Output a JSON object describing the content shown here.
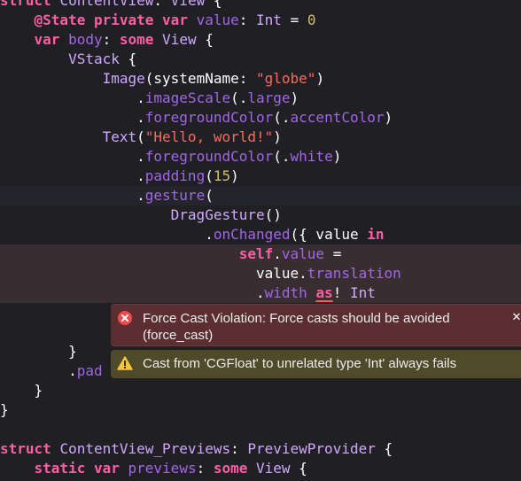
{
  "code_lines": [
    {
      "tokens": [
        {
          "t": "struct ",
          "c": "kw"
        },
        {
          "t": "ContentView",
          "c": "ty"
        },
        {
          "t": ": ",
          "c": "plain"
        },
        {
          "t": "View",
          "c": "ty"
        },
        {
          "t": " {",
          "c": "plain"
        }
      ]
    },
    {
      "tokens": [
        {
          "t": "    ",
          "c": "plain"
        },
        {
          "t": "@State",
          "c": "kw"
        },
        {
          "t": " ",
          "c": "plain"
        },
        {
          "t": "private",
          "c": "kw"
        },
        {
          "t": " ",
          "c": "plain"
        },
        {
          "t": "var",
          "c": "kw"
        },
        {
          "t": " ",
          "c": "plain"
        },
        {
          "t": "value",
          "c": "fn"
        },
        {
          "t": ": ",
          "c": "plain"
        },
        {
          "t": "Int",
          "c": "ty"
        },
        {
          "t": " = ",
          "c": "plain"
        },
        {
          "t": "0",
          "c": "num"
        }
      ]
    },
    {
      "tokens": [
        {
          "t": "    ",
          "c": "plain"
        },
        {
          "t": "var",
          "c": "kw"
        },
        {
          "t": " ",
          "c": "plain"
        },
        {
          "t": "body",
          "c": "fn"
        },
        {
          "t": ": ",
          "c": "plain"
        },
        {
          "t": "some",
          "c": "kw"
        },
        {
          "t": " ",
          "c": "plain"
        },
        {
          "t": "View",
          "c": "ty"
        },
        {
          "t": " {",
          "c": "plain"
        }
      ]
    },
    {
      "tokens": [
        {
          "t": "        ",
          "c": "plain"
        },
        {
          "t": "VStack",
          "c": "ty"
        },
        {
          "t": " {",
          "c": "plain"
        }
      ]
    },
    {
      "tokens": [
        {
          "t": "            ",
          "c": "plain"
        },
        {
          "t": "Image",
          "c": "ty"
        },
        {
          "t": "(systemName: ",
          "c": "plain"
        },
        {
          "t": "\"globe\"",
          "c": "str"
        },
        {
          "t": ")",
          "c": "plain"
        }
      ]
    },
    {
      "tokens": [
        {
          "t": "                .",
          "c": "plain"
        },
        {
          "t": "imageScale",
          "c": "fn"
        },
        {
          "t": "(.",
          "c": "plain"
        },
        {
          "t": "large",
          "c": "fn"
        },
        {
          "t": ")",
          "c": "plain"
        }
      ]
    },
    {
      "tokens": [
        {
          "t": "                .",
          "c": "plain"
        },
        {
          "t": "foregroundColor",
          "c": "fn"
        },
        {
          "t": "(.",
          "c": "plain"
        },
        {
          "t": "accentColor",
          "c": "fn"
        },
        {
          "t": ")",
          "c": "plain"
        }
      ]
    },
    {
      "tokens": [
        {
          "t": "            ",
          "c": "plain"
        },
        {
          "t": "Text",
          "c": "ty"
        },
        {
          "t": "(",
          "c": "plain"
        },
        {
          "t": "\"Hello, world!\"",
          "c": "str"
        },
        {
          "t": ")",
          "c": "plain"
        }
      ]
    },
    {
      "tokens": [
        {
          "t": "                .",
          "c": "plain"
        },
        {
          "t": "foregroundColor",
          "c": "fn"
        },
        {
          "t": "(.",
          "c": "plain"
        },
        {
          "t": "white",
          "c": "fn"
        },
        {
          "t": ")",
          "c": "plain"
        }
      ]
    },
    {
      "tokens": [
        {
          "t": "                .",
          "c": "plain"
        },
        {
          "t": "padding",
          "c": "fn"
        },
        {
          "t": "(",
          "c": "plain"
        },
        {
          "t": "15",
          "c": "num"
        },
        {
          "t": ")",
          "c": "plain"
        }
      ]
    },
    {
      "hl": "current",
      "tokens": [
        {
          "t": "                .",
          "c": "plain"
        },
        {
          "t": "gesture",
          "c": "fn"
        },
        {
          "t": "(",
          "c": "plain"
        }
      ]
    },
    {
      "tokens": [
        {
          "t": "                    ",
          "c": "plain"
        },
        {
          "t": "DragGesture",
          "c": "ty"
        },
        {
          "t": "()",
          "c": "plain"
        }
      ]
    },
    {
      "tokens": [
        {
          "t": "                        .",
          "c": "plain"
        },
        {
          "t": "onChanged",
          "c": "fn"
        },
        {
          "t": "({ value ",
          "c": "plain"
        },
        {
          "t": "in",
          "c": "kw"
        }
      ]
    },
    {
      "hl": "error",
      "tokens": [
        {
          "t": "                            ",
          "c": "plain"
        },
        {
          "t": "self",
          "c": "kw"
        },
        {
          "t": ".",
          "c": "plain"
        },
        {
          "t": "value",
          "c": "fn"
        },
        {
          "t": " =",
          "c": "plain"
        }
      ]
    },
    {
      "hl": "error",
      "tokens": [
        {
          "t": "                              value.",
          "c": "plain"
        },
        {
          "t": "translation",
          "c": "fn"
        }
      ]
    },
    {
      "hl": "error",
      "tokens": [
        {
          "t": "                              .",
          "c": "plain"
        },
        {
          "t": "width",
          "c": "fn"
        },
        {
          "t": " ",
          "c": "plain"
        },
        {
          "t": "as",
          "c": "kw",
          "u": true
        },
        {
          "t": "! ",
          "c": "plain"
        },
        {
          "t": "Int",
          "c": "ty"
        }
      ]
    },
    {
      "tokens": [
        {
          "t": "",
          "c": "plain"
        }
      ]
    },
    {
      "tokens": [
        {
          "t": "",
          "c": "plain"
        }
      ]
    },
    {
      "tokens": [
        {
          "t": "        }",
          "c": "plain"
        }
      ]
    },
    {
      "tokens": [
        {
          "t": "        .",
          "c": "plain"
        },
        {
          "t": "pad",
          "c": "fn"
        }
      ]
    },
    {
      "tokens": [
        {
          "t": "    }",
          "c": "plain"
        }
      ]
    },
    {
      "tokens": [
        {
          "t": "}",
          "c": "plain"
        }
      ]
    },
    {
      "tokens": [
        {
          "t": "",
          "c": "plain"
        }
      ]
    },
    {
      "tokens": [
        {
          "t": "struct ",
          "c": "kw"
        },
        {
          "t": "ContentView_Previews",
          "c": "ty"
        },
        {
          "t": ": ",
          "c": "plain"
        },
        {
          "t": "PreviewProvider",
          "c": "ty"
        },
        {
          "t": " {",
          "c": "plain"
        }
      ]
    },
    {
      "tokens": [
        {
          "t": "    ",
          "c": "plain"
        },
        {
          "t": "static",
          "c": "kw"
        },
        {
          "t": " ",
          "c": "plain"
        },
        {
          "t": "var",
          "c": "kw"
        },
        {
          "t": " ",
          "c": "plain"
        },
        {
          "t": "previews",
          "c": "fn"
        },
        {
          "t": ": ",
          "c": "plain"
        },
        {
          "t": "some",
          "c": "kw"
        },
        {
          "t": " ",
          "c": "plain"
        },
        {
          "t": "View",
          "c": "ty"
        },
        {
          "t": " {",
          "c": "plain"
        }
      ]
    }
  ],
  "diagnostics": {
    "error": {
      "icon": "error-circle-icon",
      "message": "Force Cast Violation: Force casts should be avoided (force_cast)",
      "close_label": "✕",
      "color": "#5b2f32"
    },
    "warning": {
      "icon": "warning-triangle-icon",
      "message": "Cast from 'CGFloat' to unrelated type 'Int' always fails",
      "color": "#4e4a2a"
    }
  },
  "colors": {
    "background": "#1f1f24",
    "keyword": "#fc5fa3",
    "type": "#d0a8ff",
    "function": "#a167e6",
    "string": "#fc6a5d",
    "number": "#d0bf69"
  }
}
